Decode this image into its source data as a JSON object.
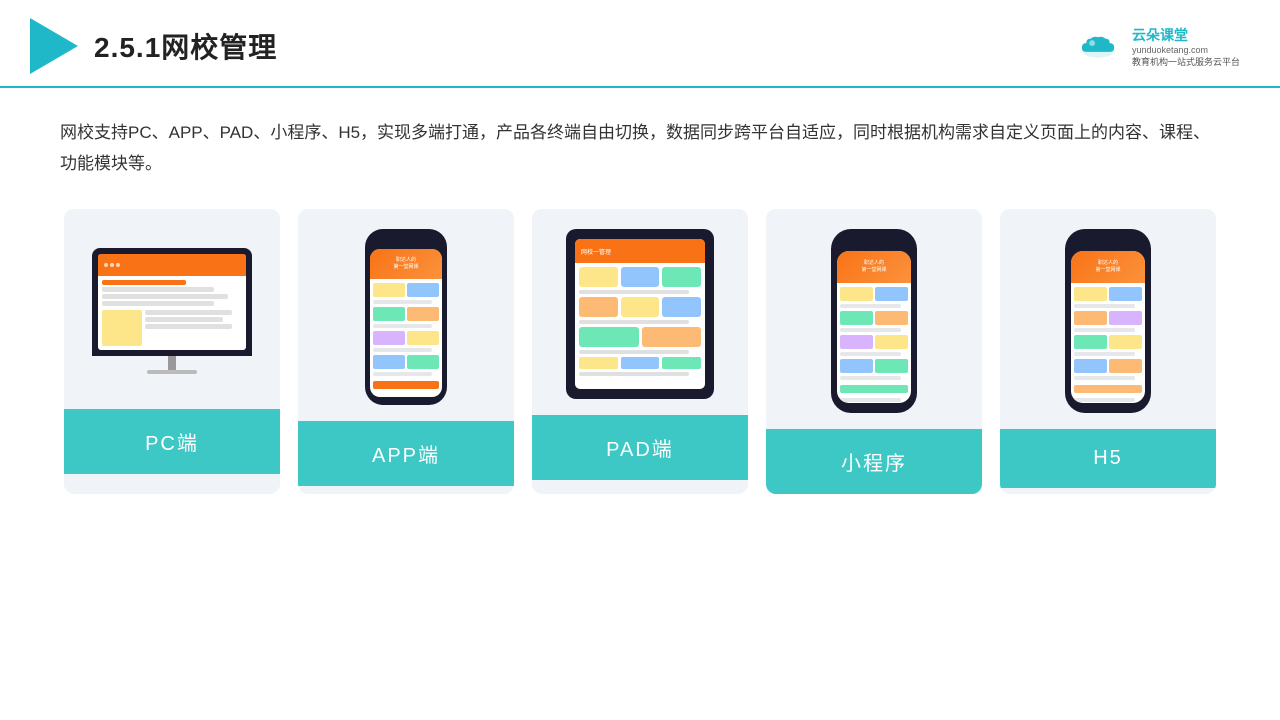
{
  "header": {
    "title": "2.5.1网校管理",
    "brand": {
      "name": "云朵课堂",
      "url": "yunduoketang.com",
      "tagline_line1": "教育机构一站",
      "tagline_line2": "式服务云平台"
    }
  },
  "main": {
    "description": "网校支持PC、APP、PAD、小程序、H5，实现多端打通，产品各终端自由切换，数据同步跨平台自适应，同时根据机构需求自定义页面上的内容、课程、功能模块等。"
  },
  "cards": [
    {
      "id": "pc",
      "label": "PC端",
      "type": "pc"
    },
    {
      "id": "app",
      "label": "APP端",
      "type": "phone"
    },
    {
      "id": "pad",
      "label": "PAD端",
      "type": "tablet"
    },
    {
      "id": "miniprogram",
      "label": "小程序",
      "type": "phone2"
    },
    {
      "id": "h5",
      "label": "H5",
      "type": "phone3"
    }
  ],
  "colors": {
    "accent": "#3dc8c6",
    "dark": "#1a1a2e",
    "orange": "#f97316"
  }
}
